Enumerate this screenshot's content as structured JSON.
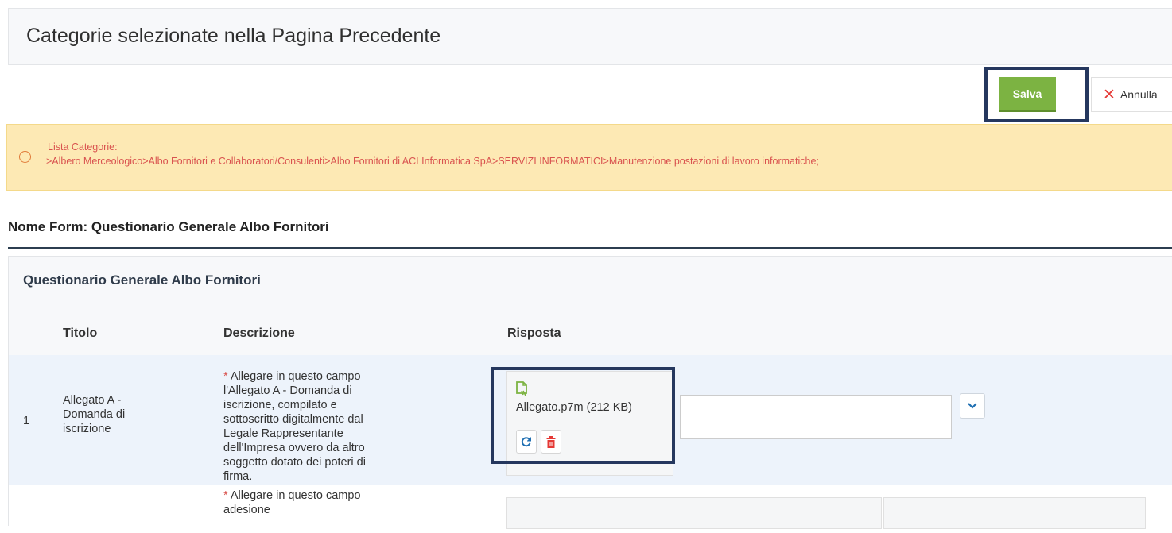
{
  "header": {
    "title": "Categorie selezionate nella Pagina Precedente"
  },
  "toolbar": {
    "save_label": "Salva",
    "cancel_label": "Annulla"
  },
  "alert": {
    "title": "Lista Categorie:",
    "path": ">Albero Merceologico>Albo Fornitori e Collaboratori/Consulenti>Albo Fornitori di ACI Informatica SpA>SERVIZI INFORMATICI>Manutenzione postazioni di lavoro informatiche;",
    "icon": "info-icon"
  },
  "form": {
    "name": "Nome Form: Questionario Generale Albo Fornitori",
    "panel_title": "Questionario Generale Albo Fornitori",
    "columns": [
      "Titolo",
      "Descrizione",
      "Risposta"
    ],
    "rows": [
      {
        "number": "1",
        "title": "Allegato A - Domanda di iscrizione",
        "required_mark": "*",
        "description": "Allegare in questo campo l'Allegato A - Domanda di iscrizione, compilato e sottoscritto digitalmente dal Legale Rappresentante dell'Impresa ovvero da altro soggetto dotato dei poteri di firma.",
        "file_name": "Allegato.p7m (212 KB)",
        "comment_value": ""
      },
      {
        "required_mark": "*",
        "description": "Allegare in questo campo adesione"
      }
    ]
  },
  "colors": {
    "accent_green": "#7cb342",
    "alert_bg": "#fde9b4",
    "alert_text": "#d9534f",
    "highlight_border": "#25375e",
    "row_bg": "#edf3fb"
  }
}
